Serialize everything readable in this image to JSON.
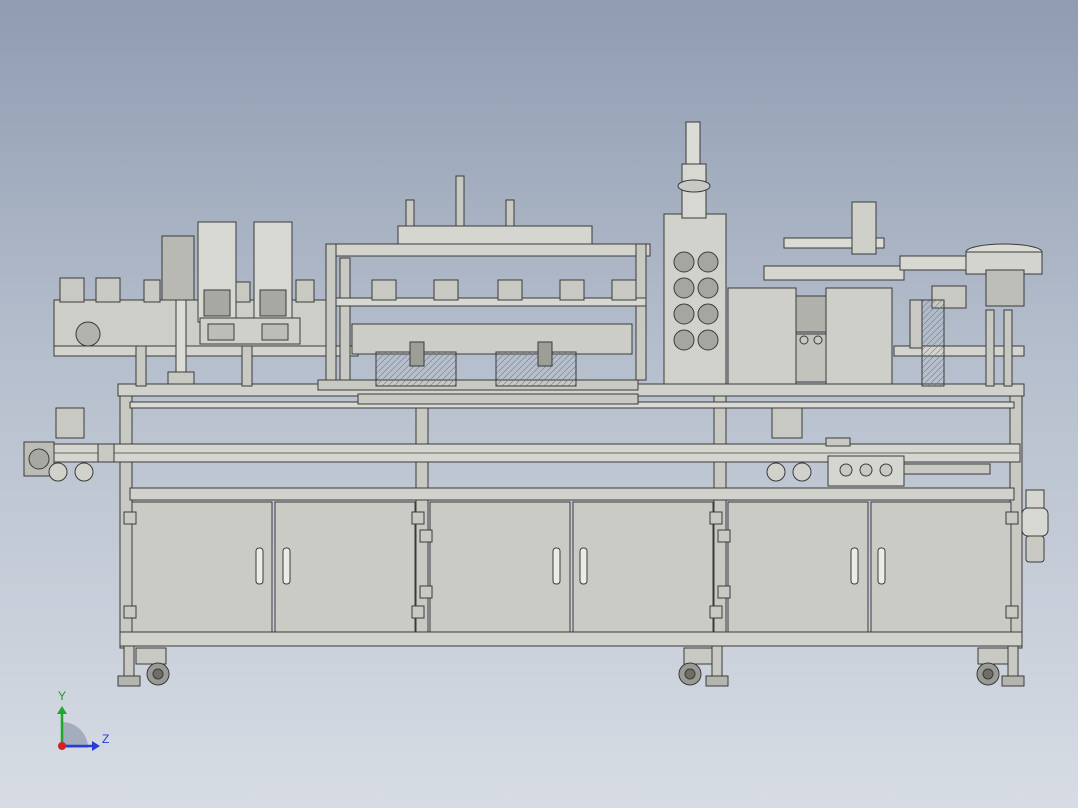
{
  "viewport": {
    "background_top": "#8f9cb1",
    "background_bottom": "#d7dce4",
    "model_fill": "#c9c9c3",
    "model_stroke": "#3a3a3a"
  },
  "triad": {
    "y_label": "Y",
    "z_label": "Z",
    "colors": {
      "y": "#1fa82e",
      "z": "#2a3bd8",
      "origin": "#d42020"
    }
  }
}
